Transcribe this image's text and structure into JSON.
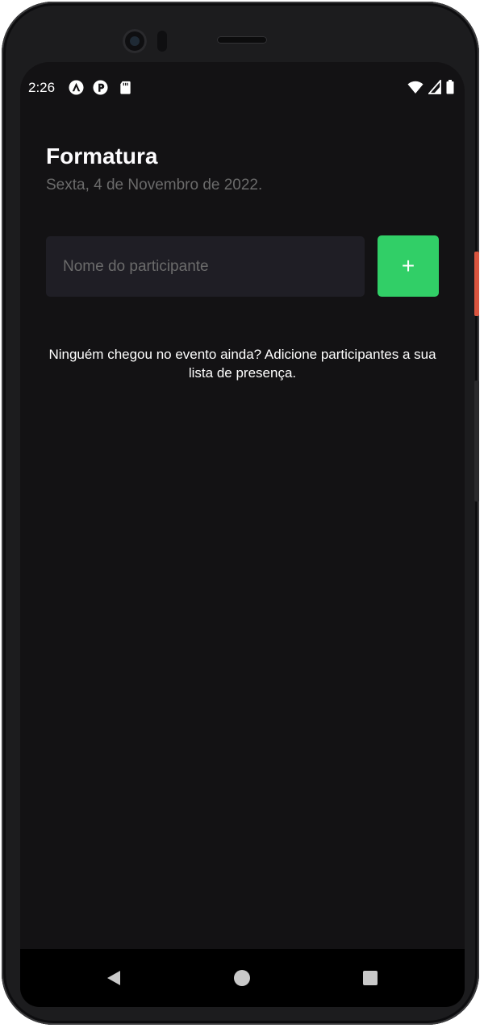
{
  "status_bar": {
    "time": "2:26",
    "left_icons": [
      "arch-app-icon",
      "pinterest-app-icon",
      "sd-card-icon"
    ],
    "right_icons": [
      "wifi-icon",
      "signal-icon",
      "battery-icon"
    ]
  },
  "event": {
    "title": "Formatura",
    "date": "Sexta, 4 de Novembro de 2022."
  },
  "participant_input": {
    "placeholder": "Nome do participante",
    "value": ""
  },
  "add_button": {
    "label": "+",
    "color": "#31cf67"
  },
  "empty_state": {
    "message": "Ninguém chegou no evento ainda? Adicione participantes a sua lista de presença."
  },
  "nav_bar": {
    "icons": [
      "back-icon",
      "home-icon",
      "recents-icon"
    ]
  },
  "colors": {
    "background": "#131214",
    "input_background": "#1f1e25",
    "muted_text": "#6b6b6b",
    "accent": "#31cf67"
  }
}
